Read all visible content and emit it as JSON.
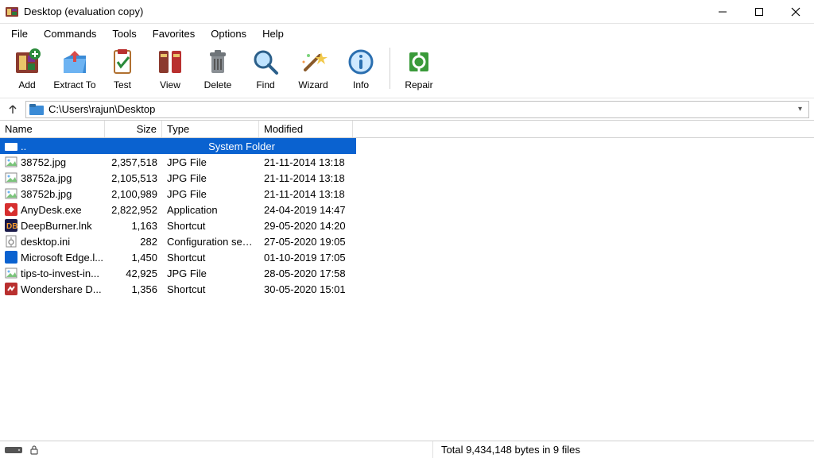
{
  "window": {
    "title": "Desktop (evaluation copy)"
  },
  "menu": {
    "file": "File",
    "commands": "Commands",
    "tools": "Tools",
    "favorites": "Favorites",
    "options": "Options",
    "help": "Help"
  },
  "toolbar": {
    "add": "Add",
    "extract_to": "Extract To",
    "test": "Test",
    "view": "View",
    "delete": "Delete",
    "find": "Find",
    "wizard": "Wizard",
    "info": "Info",
    "repair": "Repair"
  },
  "path": {
    "value": "C:\\Users\\rajun\\Desktop"
  },
  "columns": {
    "name": "Name",
    "size": "Size",
    "type": "Type",
    "modified": "Modified"
  },
  "parent_row": {
    "name": "..",
    "type": "System Folder"
  },
  "files": [
    {
      "icon": "image",
      "name": "38752.jpg",
      "size": "2,357,518",
      "type": "JPG File",
      "modified": "21-11-2014 13:18"
    },
    {
      "icon": "image",
      "name": "38752a.jpg",
      "size": "2,105,513",
      "type": "JPG File",
      "modified": "21-11-2014 13:18"
    },
    {
      "icon": "image",
      "name": "38752b.jpg",
      "size": "2,100,989",
      "type": "JPG File",
      "modified": "21-11-2014 13:18"
    },
    {
      "icon": "anydesk",
      "name": "AnyDesk.exe",
      "size": "2,822,952",
      "type": "Application",
      "modified": "24-04-2019 14:47"
    },
    {
      "icon": "deepburner",
      "name": "DeepBurner.lnk",
      "size": "1,163",
      "type": "Shortcut",
      "modified": "29-05-2020 14:20"
    },
    {
      "icon": "config",
      "name": "desktop.ini",
      "size": "282",
      "type": "Configuration setti...",
      "modified": "27-05-2020 19:05"
    },
    {
      "icon": "edge",
      "name": "Microsoft Edge.l...",
      "size": "1,450",
      "type": "Shortcut",
      "modified": "01-10-2019 17:05"
    },
    {
      "icon": "image",
      "name": "tips-to-invest-in...",
      "size": "42,925",
      "type": "JPG File",
      "modified": "28-05-2020 17:58"
    },
    {
      "icon": "wondershare",
      "name": "Wondershare D...",
      "size": "1,356",
      "type": "Shortcut",
      "modified": "30-05-2020 15:01"
    }
  ],
  "status": {
    "summary": "Total 9,434,148 bytes in 9 files"
  }
}
